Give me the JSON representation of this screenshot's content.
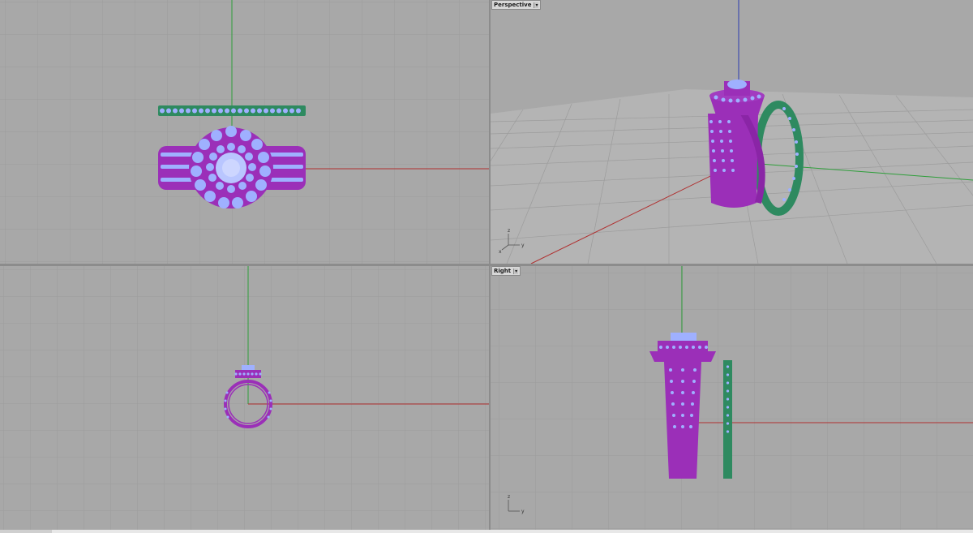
{
  "viewports": {
    "top": {
      "label": ""
    },
    "perspective": {
      "label": "Perspective",
      "menu_icon": "chevron-down-icon"
    },
    "front": {
      "label": ""
    },
    "right": {
      "label": "Right",
      "menu_icon": "chevron-down-icon"
    }
  },
  "axes": {
    "x": "x",
    "y": "y",
    "z": "z"
  },
  "colors": {
    "background": "#a8a8a8",
    "grid": "#9a9a9a",
    "grid_major": "#8f8f8f",
    "axis_x": "#b03030",
    "axis_y": "#2e9e3a",
    "axis_z": "#2c3cb0",
    "engagement_ring": "#9b2fb8",
    "stones": "#9fb0ff",
    "band": "#2e8a60"
  }
}
